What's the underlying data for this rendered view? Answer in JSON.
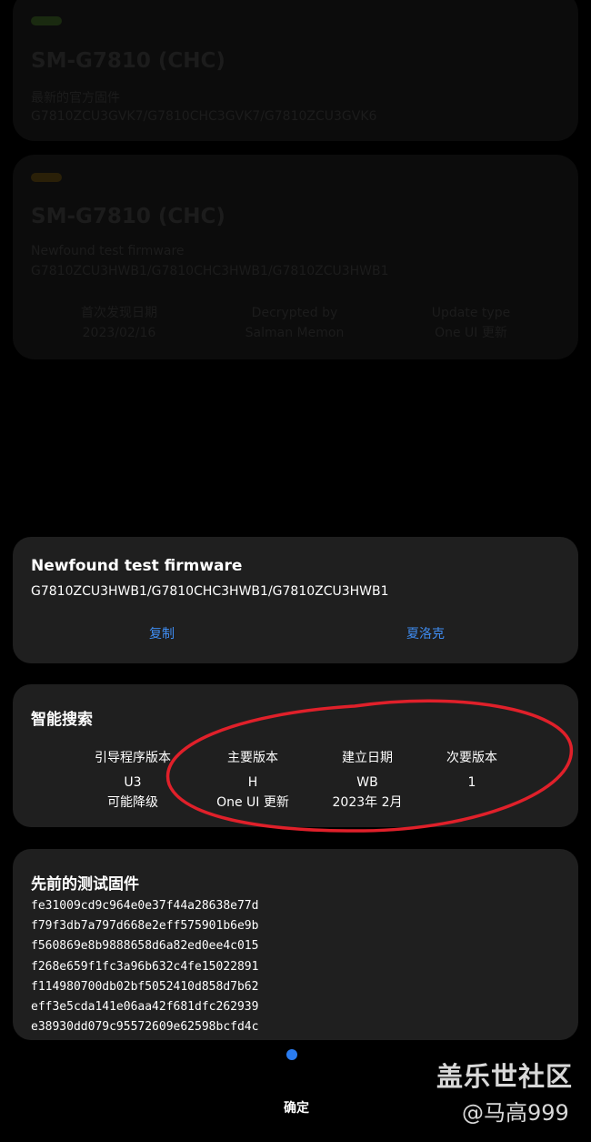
{
  "background": {
    "card1": {
      "title": "SM-G7810 (CHC)",
      "subtitle": "最新的官方固件",
      "versions": "G7810ZCU3GVK7/G7810CHC3GVK7/G7810ZCU3GVK6"
    },
    "card2": {
      "title": "SM-G7810 (CHC)",
      "subtitle": "Newfound test firmware",
      "versions": "G7810ZCU3HWB1/G7810CHC3HWB1/G7810ZCU3HWB1",
      "stats": [
        {
          "label": "首次发现日期",
          "value": "2023/02/16"
        },
        {
          "label": "Decrypted by",
          "value": "Salman Memon"
        },
        {
          "label": "Update type",
          "value": "One UI 更新"
        }
      ]
    }
  },
  "firmware_card": {
    "title": "Newfound test firmware",
    "value": "G7810ZCU3HWB1/G7810CHC3HWB1/G7810ZCU3HWB1",
    "copy_label": "复制",
    "sherlock_label": "夏洛克"
  },
  "smart_search": {
    "title": "智能搜索",
    "columns": [
      {
        "header": "引导程序版本",
        "value": "U3",
        "note": "可能降级"
      },
      {
        "header": "主要版本",
        "value": "H",
        "note": "One UI 更新"
      },
      {
        "header": "建立日期",
        "value": "WB",
        "note": "2023年 2月"
      },
      {
        "header": "次要版本",
        "value": "1",
        "note": ""
      }
    ]
  },
  "previous_test": {
    "title": "先前的测试固件",
    "hashes": [
      "fe31009cd9c964e0e37f44a28638e77d",
      "f79f3db7a797d668e2eff575901b6e9b",
      "f560869e8b9888658d6a82ed0ee4c015",
      "f268e659f1fc3a96b632c4fe15022891",
      "f114980700db02bf5052410d858d7b62",
      "eff3e5cda141e06aa42f681dfc262939",
      "e38930dd079c95572609e62598bcfd4c"
    ]
  },
  "footer": {
    "ok_label": "确定"
  },
  "watermark": {
    "brand": "盖乐世社区",
    "user": "@马高999"
  },
  "colors": {
    "accent": "#3f8cf0",
    "annotation": "#e0202a",
    "card": "#1f1f1f",
    "background": "#000000"
  }
}
